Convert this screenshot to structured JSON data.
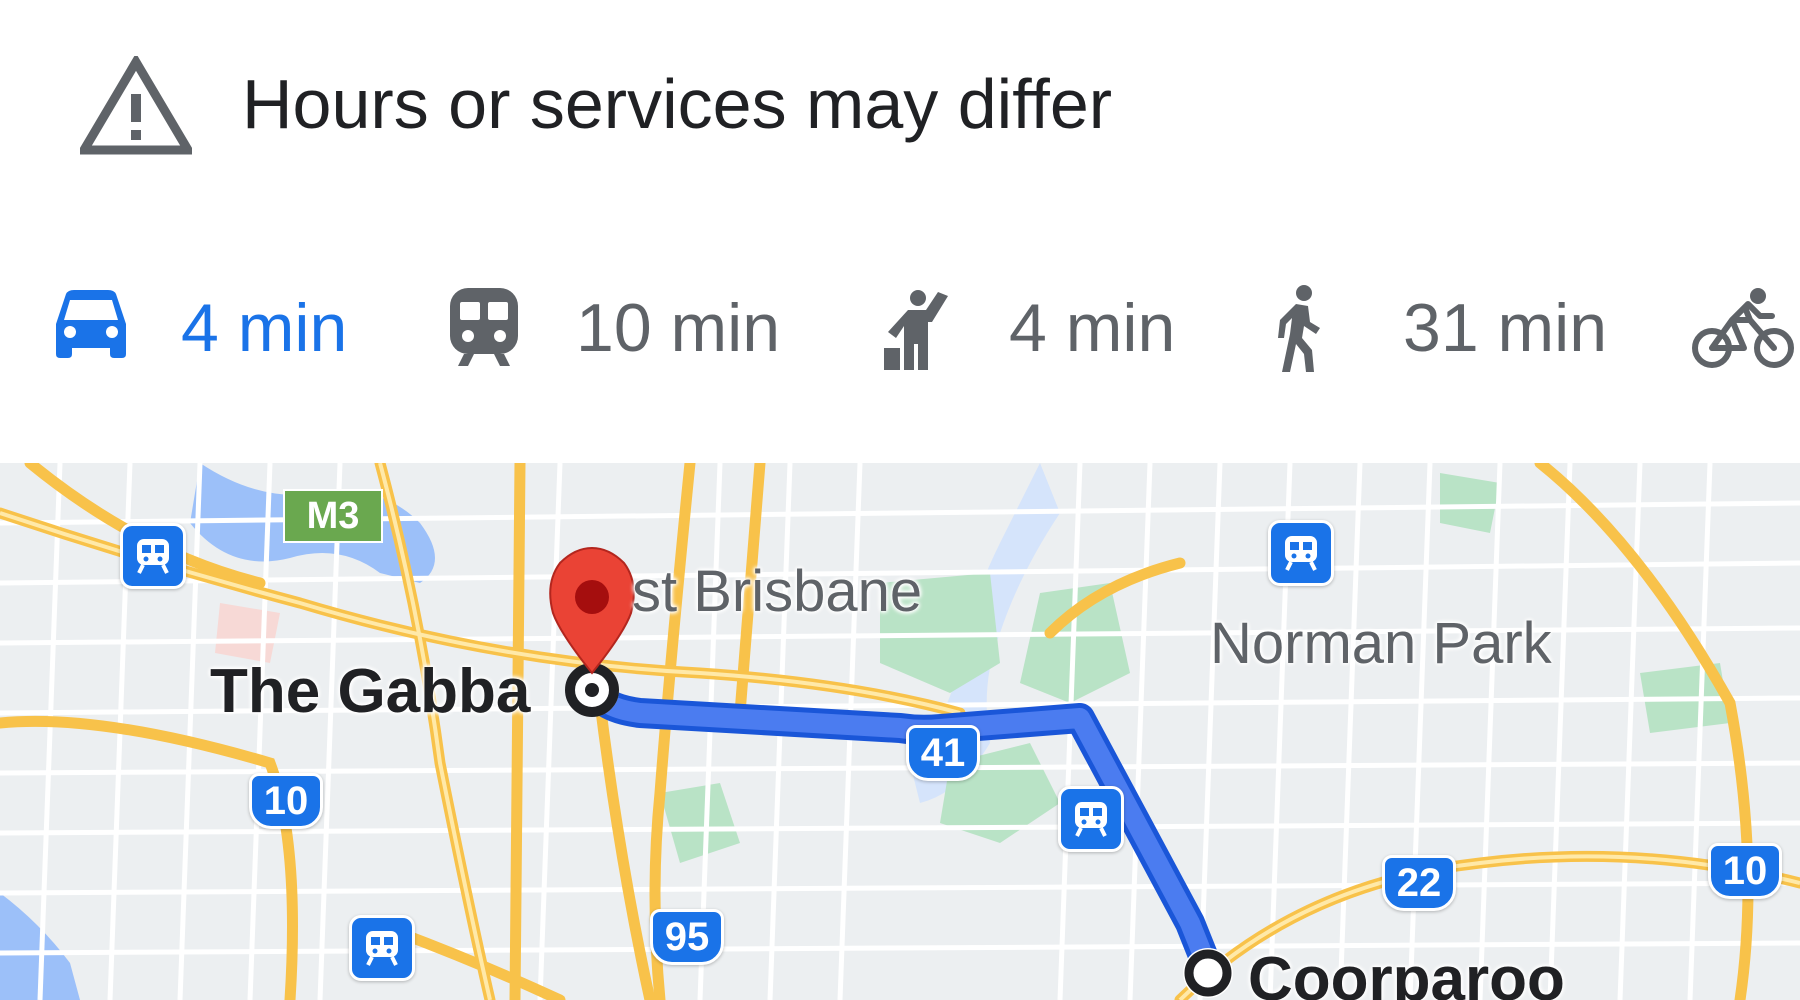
{
  "alert": {
    "icon": "warning-icon",
    "text": "Hours or services may differ"
  },
  "travel_modes": [
    {
      "mode": "driving",
      "icon": "car-icon",
      "label": "4 min",
      "selected": true
    },
    {
      "mode": "transit",
      "icon": "train-icon",
      "label": "10 min",
      "selected": false
    },
    {
      "mode": "ride-hailing",
      "icon": "hail-icon",
      "label": "4 min",
      "selected": false
    },
    {
      "mode": "walking",
      "icon": "walking-icon",
      "label": "31 min",
      "selected": false
    },
    {
      "mode": "cycling",
      "icon": "bicycle-icon",
      "label": "",
      "selected": false
    }
  ],
  "map": {
    "labels": {
      "area_east_brisbane": "st Brisbane",
      "area_norman_park": "Norman Park",
      "place_origin": "The Gabba",
      "place_destination": "Coorparoo"
    },
    "shields": {
      "m3": "M3",
      "r41": "41",
      "r10_left": "10",
      "r10_right": "10",
      "r22": "22",
      "r95": "95"
    },
    "pins": {
      "destination": "red-pin-icon",
      "origin": "origin-ring-icon",
      "end": "end-ring-icon"
    },
    "colors": {
      "route": "#4b7cf0",
      "route_outline": "#1a56d8",
      "major_road": "#f8c24a",
      "park": "#b9e3c6",
      "water": "#9cc0f9",
      "pin": "#ea4335"
    }
  }
}
